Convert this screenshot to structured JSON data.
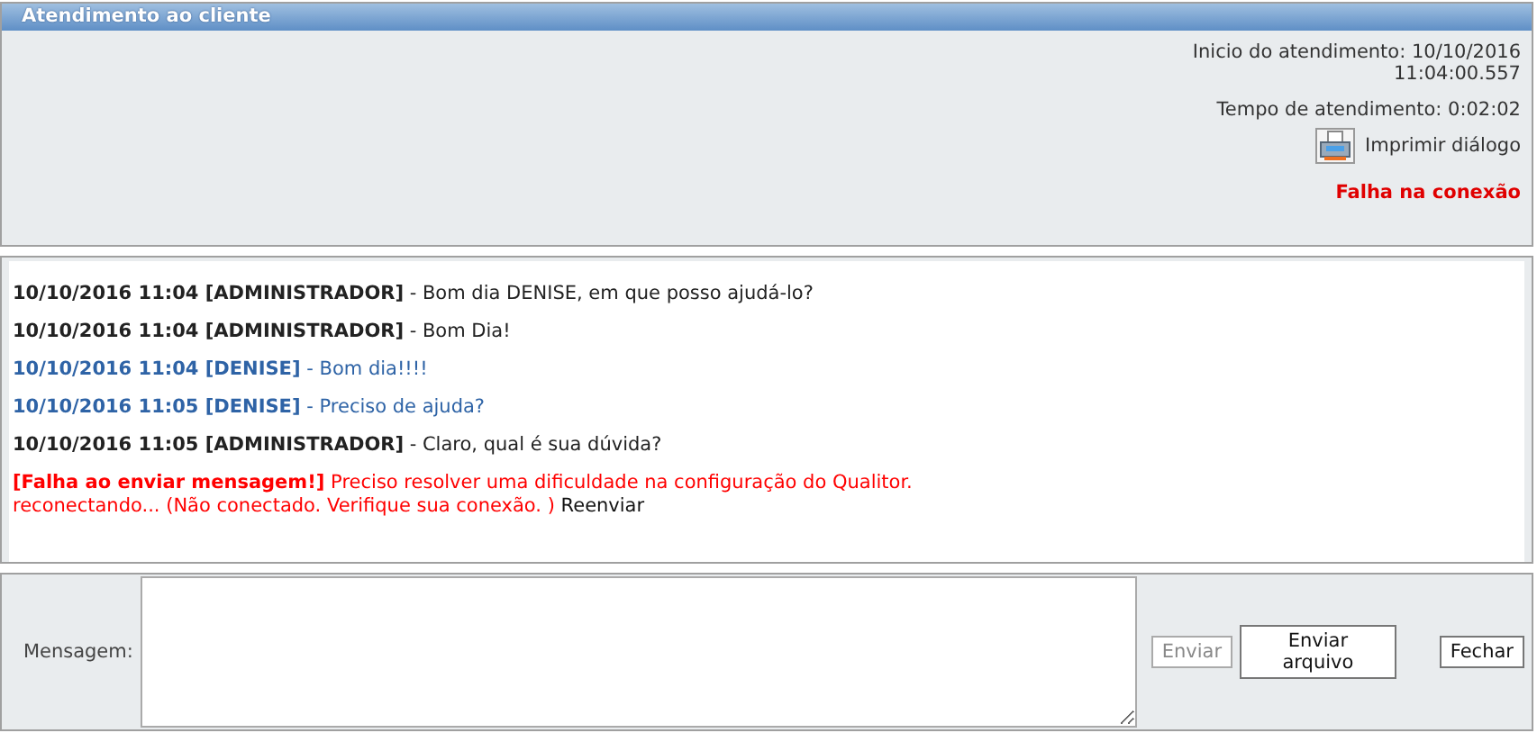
{
  "window": {
    "title": "Atendimento ao cliente"
  },
  "session": {
    "start_label": "Inicio do atendimento: 10/10/2016",
    "start_time": "11:04:00.557",
    "duration": "Tempo de atendimento: 0:02:02",
    "print_label": "Imprimir diálogo",
    "connection_status": "Falha na conexão"
  },
  "messages": [
    {
      "kind": "agent",
      "text": "**10/10/2016 11:04 [ADMINISTRADOR]** - Bom dia DENISE, em que posso ajudá-lo?"
    },
    {
      "kind": "agent",
      "text": "**10/10/2016 11:04 [ADMINISTRADOR]** - Bom Dia!"
    },
    {
      "kind": "client",
      "text": "**10/10/2016 11:04 [DENISE]** - Bom dia!!!!"
    },
    {
      "kind": "client",
      "text": "**10/10/2016 11:05 [DENISE]** - Preciso de ajuda?"
    },
    {
      "kind": "agent",
      "text": "**10/10/2016 11:05 [ADMINISTRADOR]** - Claro, qual é sua dúvida?"
    },
    {
      "kind": "failed",
      "text": "**[Falha ao enviar mensagem!]** Preciso resolver uma dificuldade na configuração do Qualitor.",
      "status": "reconectando... (Não conectado. Verifique sua conexão. )",
      "action": "Reenviar"
    }
  ],
  "composer": {
    "label": "Mensagem:",
    "buttons": [
      {
        "label": "Enviar",
        "disabled": true
      },
      {
        "label": "Enviar arquivo",
        "disabled": false
      }
    ],
    "close": "Fechar"
  }
}
